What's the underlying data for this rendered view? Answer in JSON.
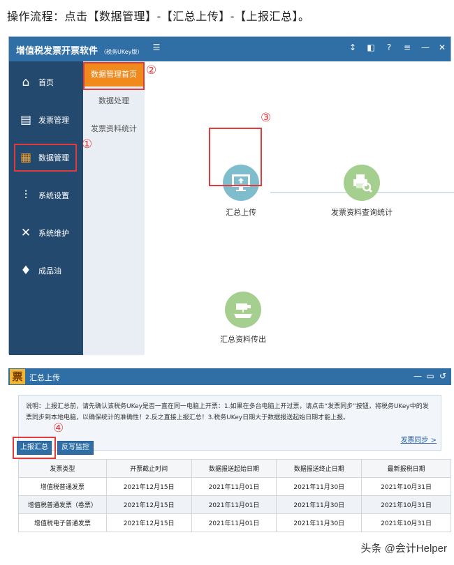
{
  "caption": "操作流程：点击【数据管理】-【汇总上传】-【上报汇总】。",
  "app": {
    "title": "增值税发票开票软件",
    "subtitle": "（税务UKey版）",
    "toolbar_icons": [
      "pin-icon",
      "restore-icon",
      "help-icon",
      "menu-icon",
      "minimize-icon",
      "close-icon"
    ]
  },
  "sidebar": {
    "items": [
      {
        "label": "首页",
        "icon": "home-icon"
      },
      {
        "label": "发票管理",
        "icon": "printer-icon"
      },
      {
        "label": "数据管理",
        "icon": "database-icon"
      },
      {
        "label": "系统设置",
        "icon": "sliders-icon"
      },
      {
        "label": "系统维护",
        "icon": "tools-icon"
      },
      {
        "label": "成品油",
        "icon": "oil-icon"
      }
    ]
  },
  "subnav": {
    "items": [
      "数据管理首页",
      "数据处理",
      "发票资料统计"
    ]
  },
  "features": {
    "upload": "汇总上传",
    "query": "发票资料查询统计",
    "export": "汇总资料传出"
  },
  "markers": {
    "one": "①",
    "two": "②",
    "three": "③",
    "four": "④"
  },
  "upload_window": {
    "title": "汇总上传",
    "icon_char": "票",
    "notice": "说明：上报汇总前，请先确认该税务UKey是否一直在同一电脑上开票：1.如果在多台电脑上开过票，请点击“发票同步”按钮，将税务UKey中的发票同步到本地电脑，以确保统计的准确性！2.反之直接上报汇总！3.税务UKey日期大于数据报送起始日期才能上报。",
    "sync_link": "发票同步 >",
    "buttons": {
      "report": "上报汇总",
      "writeback": "反写监控"
    },
    "table": {
      "headers": [
        "发票类型",
        "开票截止时间",
        "数据报送起始日期",
        "数据报送终止日期",
        "最新报税日期"
      ],
      "rows": [
        [
          "增值税普通发票",
          "2021年12月15日",
          "2021年11月01日",
          "2021年11月30日",
          "2021年10月31日"
        ],
        [
          "增值税普通发票（卷票）",
          "2021年12月15日",
          "2021年11月01日",
          "2021年11月30日",
          "2021年10月31日"
        ],
        [
          "增值税电子普通发票",
          "2021年12月15日",
          "2021年11月01日",
          "2021年11月30日",
          "2021年10月31日"
        ]
      ]
    }
  },
  "watermark": "头条 @会计Helper",
  "colors": {
    "titlebar": "#2f6fa6",
    "sidebar": "#24496e",
    "accent": "#f08a1c",
    "annotation": "#e23b3b"
  }
}
